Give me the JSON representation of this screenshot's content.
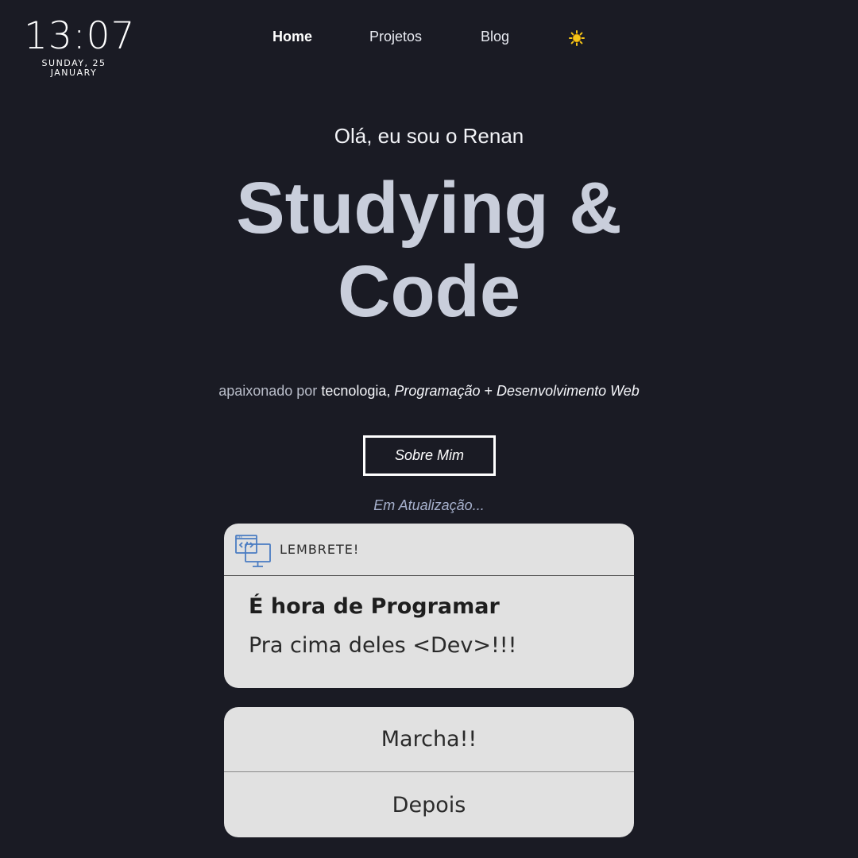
{
  "clock": {
    "time": "13:07",
    "date_line1": "SUNDAY, 25",
    "date_line2": "JANUARY"
  },
  "nav": {
    "items": [
      {
        "label": "Home"
      },
      {
        "label": "Projetos"
      },
      {
        "label": "Blog"
      }
    ],
    "theme_icon": "sun-icon"
  },
  "hero": {
    "greeting": "Olá, eu sou o Renan",
    "title_line1": "Studying &",
    "title_line2": "Code",
    "tagline": {
      "prefix": "apaixonado por",
      "tech": "tecnologia",
      "comma": ",",
      "prog": "Programação",
      "plus": "+",
      "web": "Desenvolvimento Web"
    },
    "about_button": "Sobre Mim",
    "status": "Em Atualização..."
  },
  "notification": {
    "app_icon": "code-monitor-icon",
    "app_name": "LEMBRETE!",
    "title": "É hora de Programar",
    "body": "Pra cima deles <Dev>!!!",
    "actions": [
      {
        "label": "Marcha!!"
      },
      {
        "label": "Depois"
      }
    ]
  },
  "colors": {
    "background": "#1a1b24",
    "hero_title": "#c9cedb",
    "card": "#e1e1e1",
    "icon_blue": "#4a7cc2",
    "sun": "#f5c518"
  }
}
